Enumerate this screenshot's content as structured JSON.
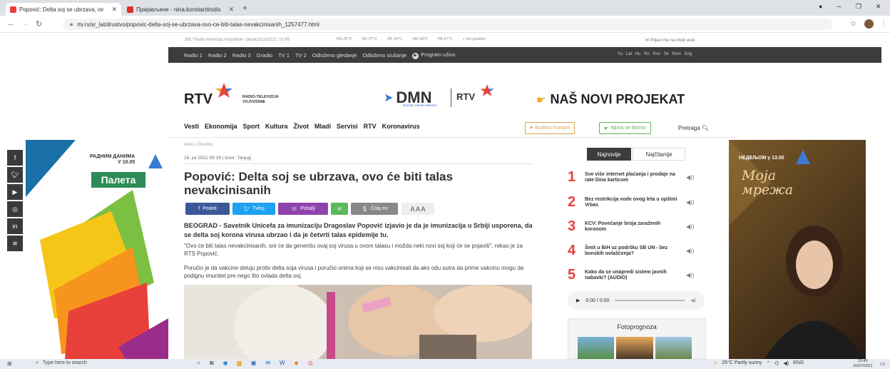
{
  "browser": {
    "tabs": [
      {
        "label": "Popović: Delta soj se ubrzava, ov",
        "active": true
      },
      {
        "label": "Пријављене - nina.konstantinidis",
        "active": false
      }
    ],
    "new_tab": "+",
    "url": "rtv.rs/sr_lat/drustvo/popovic-delta-soj-se-ubrzava-ovo-ce-biti-talas-nevakcinisanih_1257477.html"
  },
  "site": {
    "topinfo": "JMU Radio-televizija Vojvodine / petak16.jul2021. 10:45",
    "weather": [
      "NS 26°C",
      "SU 27°C",
      "ZR 26°C",
      "SM 28°C",
      "PA 27°C"
    ],
    "weather_link": "> Svi gradovi",
    "newsletter": "Prijavi me na imejl vesti",
    "radio_items": [
      "Radio 1",
      "Radio 2",
      "Radio 3",
      "Gradio",
      "TV 1",
      "TV 2",
      "Odloženo gledanje",
      "Odloženo slušanje"
    ],
    "program_uzivo": "Program uživo",
    "languages": "Yu Lat Hu Ro Rsn Sk Rom Eng",
    "logo_rtv": "RTV",
    "logo_sub": "RADIO-TELEVIZIJA VOJVODINE",
    "dmn_logo": "DMN",
    "dmn_sub": "Danube Media Network",
    "rtv_small": "RTV",
    "project_promo": "NAŠ NOVI PROJEKAT",
    "nav": [
      "Vesti",
      "Ekonomija",
      "Sport",
      "Kultura",
      "Život",
      "Mladi",
      "Servisi",
      "RTV",
      "Koronavirus"
    ],
    "budimo_humani": "Budimo humani",
    "njima_se_divimo": "Njima se divimo",
    "pretraga": "Pretraga"
  },
  "left_ad": {
    "line1": "РАДНИМ ДАНИМА",
    "line2": "У 10.05",
    "brand": "Палета"
  },
  "article": {
    "breadcrumb": "Vesti » Društvo",
    "meta": "16. jul 2021 09:19 | Izvor: Tanjug",
    "title": "Popović: Delta soj se ubrzava, ovo će biti talas nevakcinisanih",
    "share": {
      "podeli": "Podeli",
      "tvituj": "Tvituj",
      "posalji": "Pošalji",
      "citaj": "Čitaj mi",
      "font_sizes": "A A A"
    },
    "lead": "BEOGRAD - Savetnik Unicefa za imunizaciju Dragoslav Popović izjavio je da je imunizacija u Srbiji usporena, da se delta soj korona virusa ubrzao i da je četvrti talas epidemije tu.",
    "p1": "\"Ovo će biti talas nevakcinisanih, oni će da generišu ovaj soj virusa u ovom talasu i možda neki novi soj koji će se pojaviti\", rekao je za RTS Popović.",
    "p2": "Poručio je da vakcine deluju protiv delta soja virusa i poručio onima koji se nisu vakcinisali da ako odu sutra da prime vakcinu mogu da podignu imunitet pre nego što ovlada delta soj."
  },
  "sidebar": {
    "tab_najnovije": "Najnovije",
    "tab_najcitanije": "Najčitanije",
    "items": [
      {
        "num": "1",
        "text": "Sve više internet plaćanja i prodaje na rate Dina karticom"
      },
      {
        "num": "2",
        "text": "Bez restrikcija vode ovog leta u opštini Vrbas"
      },
      {
        "num": "3",
        "text": "KCV: Povećanje broja zaraženih koronom"
      },
      {
        "num": "4",
        "text": "Šmit u BiH uz podršku SB UN - bez bonskih ovlašćenja?"
      },
      {
        "num": "5",
        "text": "Kako da se unapredi sistem javnih nabavki? (AUDIO)"
      }
    ],
    "audio_time": "0:00 / 0:00",
    "fotoprognoza": "Fotoprognoza"
  },
  "right_ad": {
    "line1": "НЕДЕЉОМ у 13.00",
    "title": "Моја мрежа"
  },
  "taskbar": {
    "search": "Type here to search",
    "weather": "25°C  Partly sunny",
    "lang": "ENG",
    "time": "10:45",
    "date": "16/07/2021"
  },
  "colors": {
    "accent_red": "#e8413c",
    "facebook": "#3b5998",
    "twitter": "#1da1f2",
    "viber": "#8e44ad",
    "email": "#5cb85c",
    "read": "#888888",
    "dark_bar": "#3c3c3c"
  }
}
